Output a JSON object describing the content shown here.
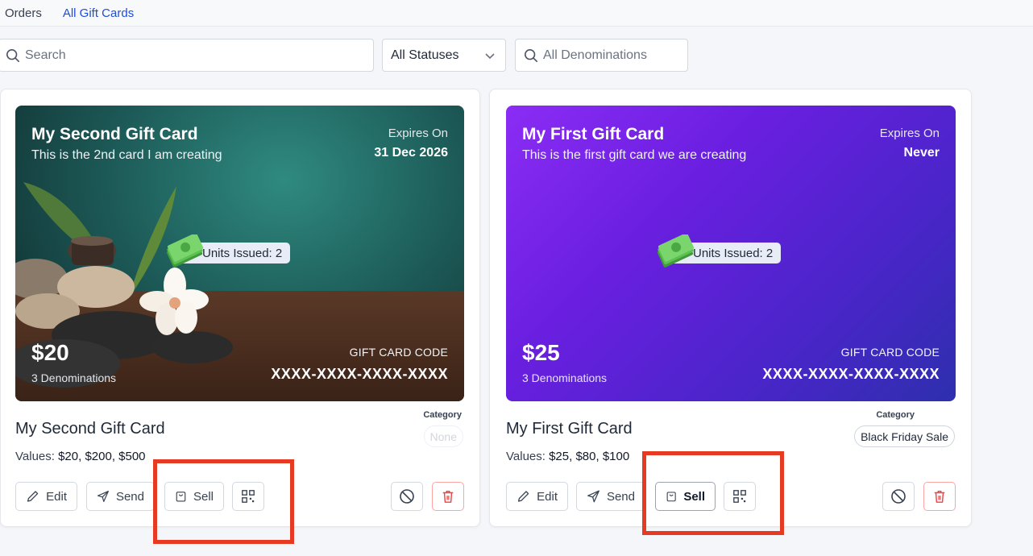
{
  "tabs": [
    {
      "label": "Orders",
      "active": false
    },
    {
      "label": "All Gift Cards",
      "active": true
    }
  ],
  "filters": {
    "search_placeholder": "Search",
    "status_value": "All Statuses",
    "denomination_placeholder": "All Denominations"
  },
  "cards": [
    {
      "title": "My Second Gift Card",
      "subtitle": "This is the 2nd card I am creating",
      "expires_label": "Expires On",
      "expires_value": "31 Dec 2026",
      "units_issued": "Units Issued: 2",
      "price": "$20",
      "denominations": "3 Denominations",
      "code_label": "GIFT CARD CODE",
      "code": "XXXX-XXXX-XXXX-XXXX",
      "name": "My Second Gift Card",
      "values_label": "Values:",
      "values": "$20, $200, $500",
      "category_label": "Category",
      "category": "None",
      "background": "spa-stones-photo",
      "buttons": {
        "edit": "Edit",
        "send": "Send",
        "sell": "Sell"
      }
    },
    {
      "title": "My First Gift Card",
      "subtitle": "This is the first gift card we are creating",
      "expires_label": "Expires On",
      "expires_value": "Never",
      "units_issued": "Units Issued: 2",
      "price": "$25",
      "denominations": "3 Denominations",
      "code_label": "GIFT CARD CODE",
      "code": "XXXX-XXXX-XXXX-XXXX",
      "name": "My First Gift Card",
      "values_label": "Values:",
      "values": "$25, $80, $100",
      "category_label": "Category",
      "category": "Black Friday Sale",
      "background": "purple-gradient",
      "buttons": {
        "edit": "Edit",
        "send": "Send",
        "sell": "Sell"
      }
    }
  ],
  "colors": {
    "accent": "#1d4ed8",
    "highlight": "#e63a23",
    "danger": "#ef4444",
    "purple_start": "#8b2cf5",
    "purple_end": "#2e2fae"
  },
  "icons": [
    "search-icon",
    "chevron-down-icon",
    "money-icon",
    "pencil-icon",
    "send-icon",
    "shopping-bag-icon",
    "qr-code-icon",
    "ban-icon",
    "trash-icon"
  ]
}
